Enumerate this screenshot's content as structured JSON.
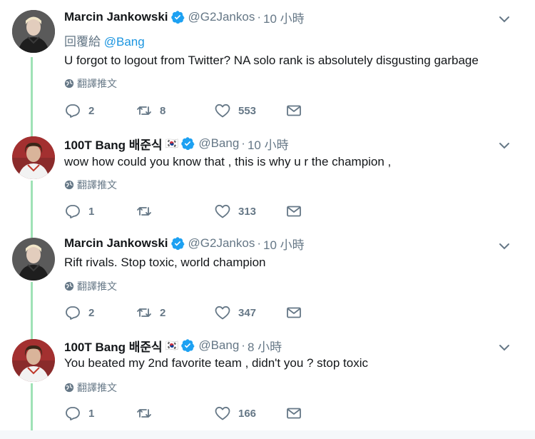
{
  "thread": {
    "tweets": [
      {
        "name": "Marcin Jankowski",
        "flag": "",
        "handle": "@G2Jankos",
        "dot": "·",
        "time": "10 小時",
        "reply_prefix": "回覆給 ",
        "reply_mention": "@Bang",
        "text": "U forgot to logout from Twitter? NA solo rank is absolutely disgusting garbage",
        "translate": "翻譯推文",
        "replies": "2",
        "retweets": "8",
        "likes": "553"
      },
      {
        "name": "100T Bang 배준식",
        "flag": "🇰🇷",
        "handle": "@Bang",
        "dot": "·",
        "time": "10 小時",
        "text": "wow how could you know that , this is why u r the champion ,",
        "translate": "翻譯推文",
        "replies": "1",
        "retweets": "",
        "likes": "313"
      },
      {
        "name": "Marcin Jankowski",
        "flag": "",
        "handle": "@G2Jankos",
        "dot": "·",
        "time": "10 小時",
        "text": "Rift rivals. Stop toxic, world champion",
        "translate": "翻譯推文",
        "replies": "2",
        "retweets": "2",
        "likes": "347"
      },
      {
        "name": "100T Bang 배준식",
        "flag": "🇰🇷",
        "handle": "@Bang",
        "dot": "·",
        "time": "8 小時",
        "text": "You beated my 2nd favorite team , didn't you ? stop toxic",
        "translate": "翻譯推文",
        "replies": "1",
        "retweets": "",
        "likes": "166"
      }
    ]
  },
  "colors": {
    "text": "#14171a",
    "muted": "#657786",
    "link": "#1b95e0",
    "verified": "#1da1f2",
    "thread_line": "#9fe2b6"
  },
  "icons": [
    "verified-badge-icon",
    "chevron-down-icon",
    "globe-icon",
    "reply-icon",
    "retweet-icon",
    "like-icon",
    "direct-message-icon"
  ]
}
